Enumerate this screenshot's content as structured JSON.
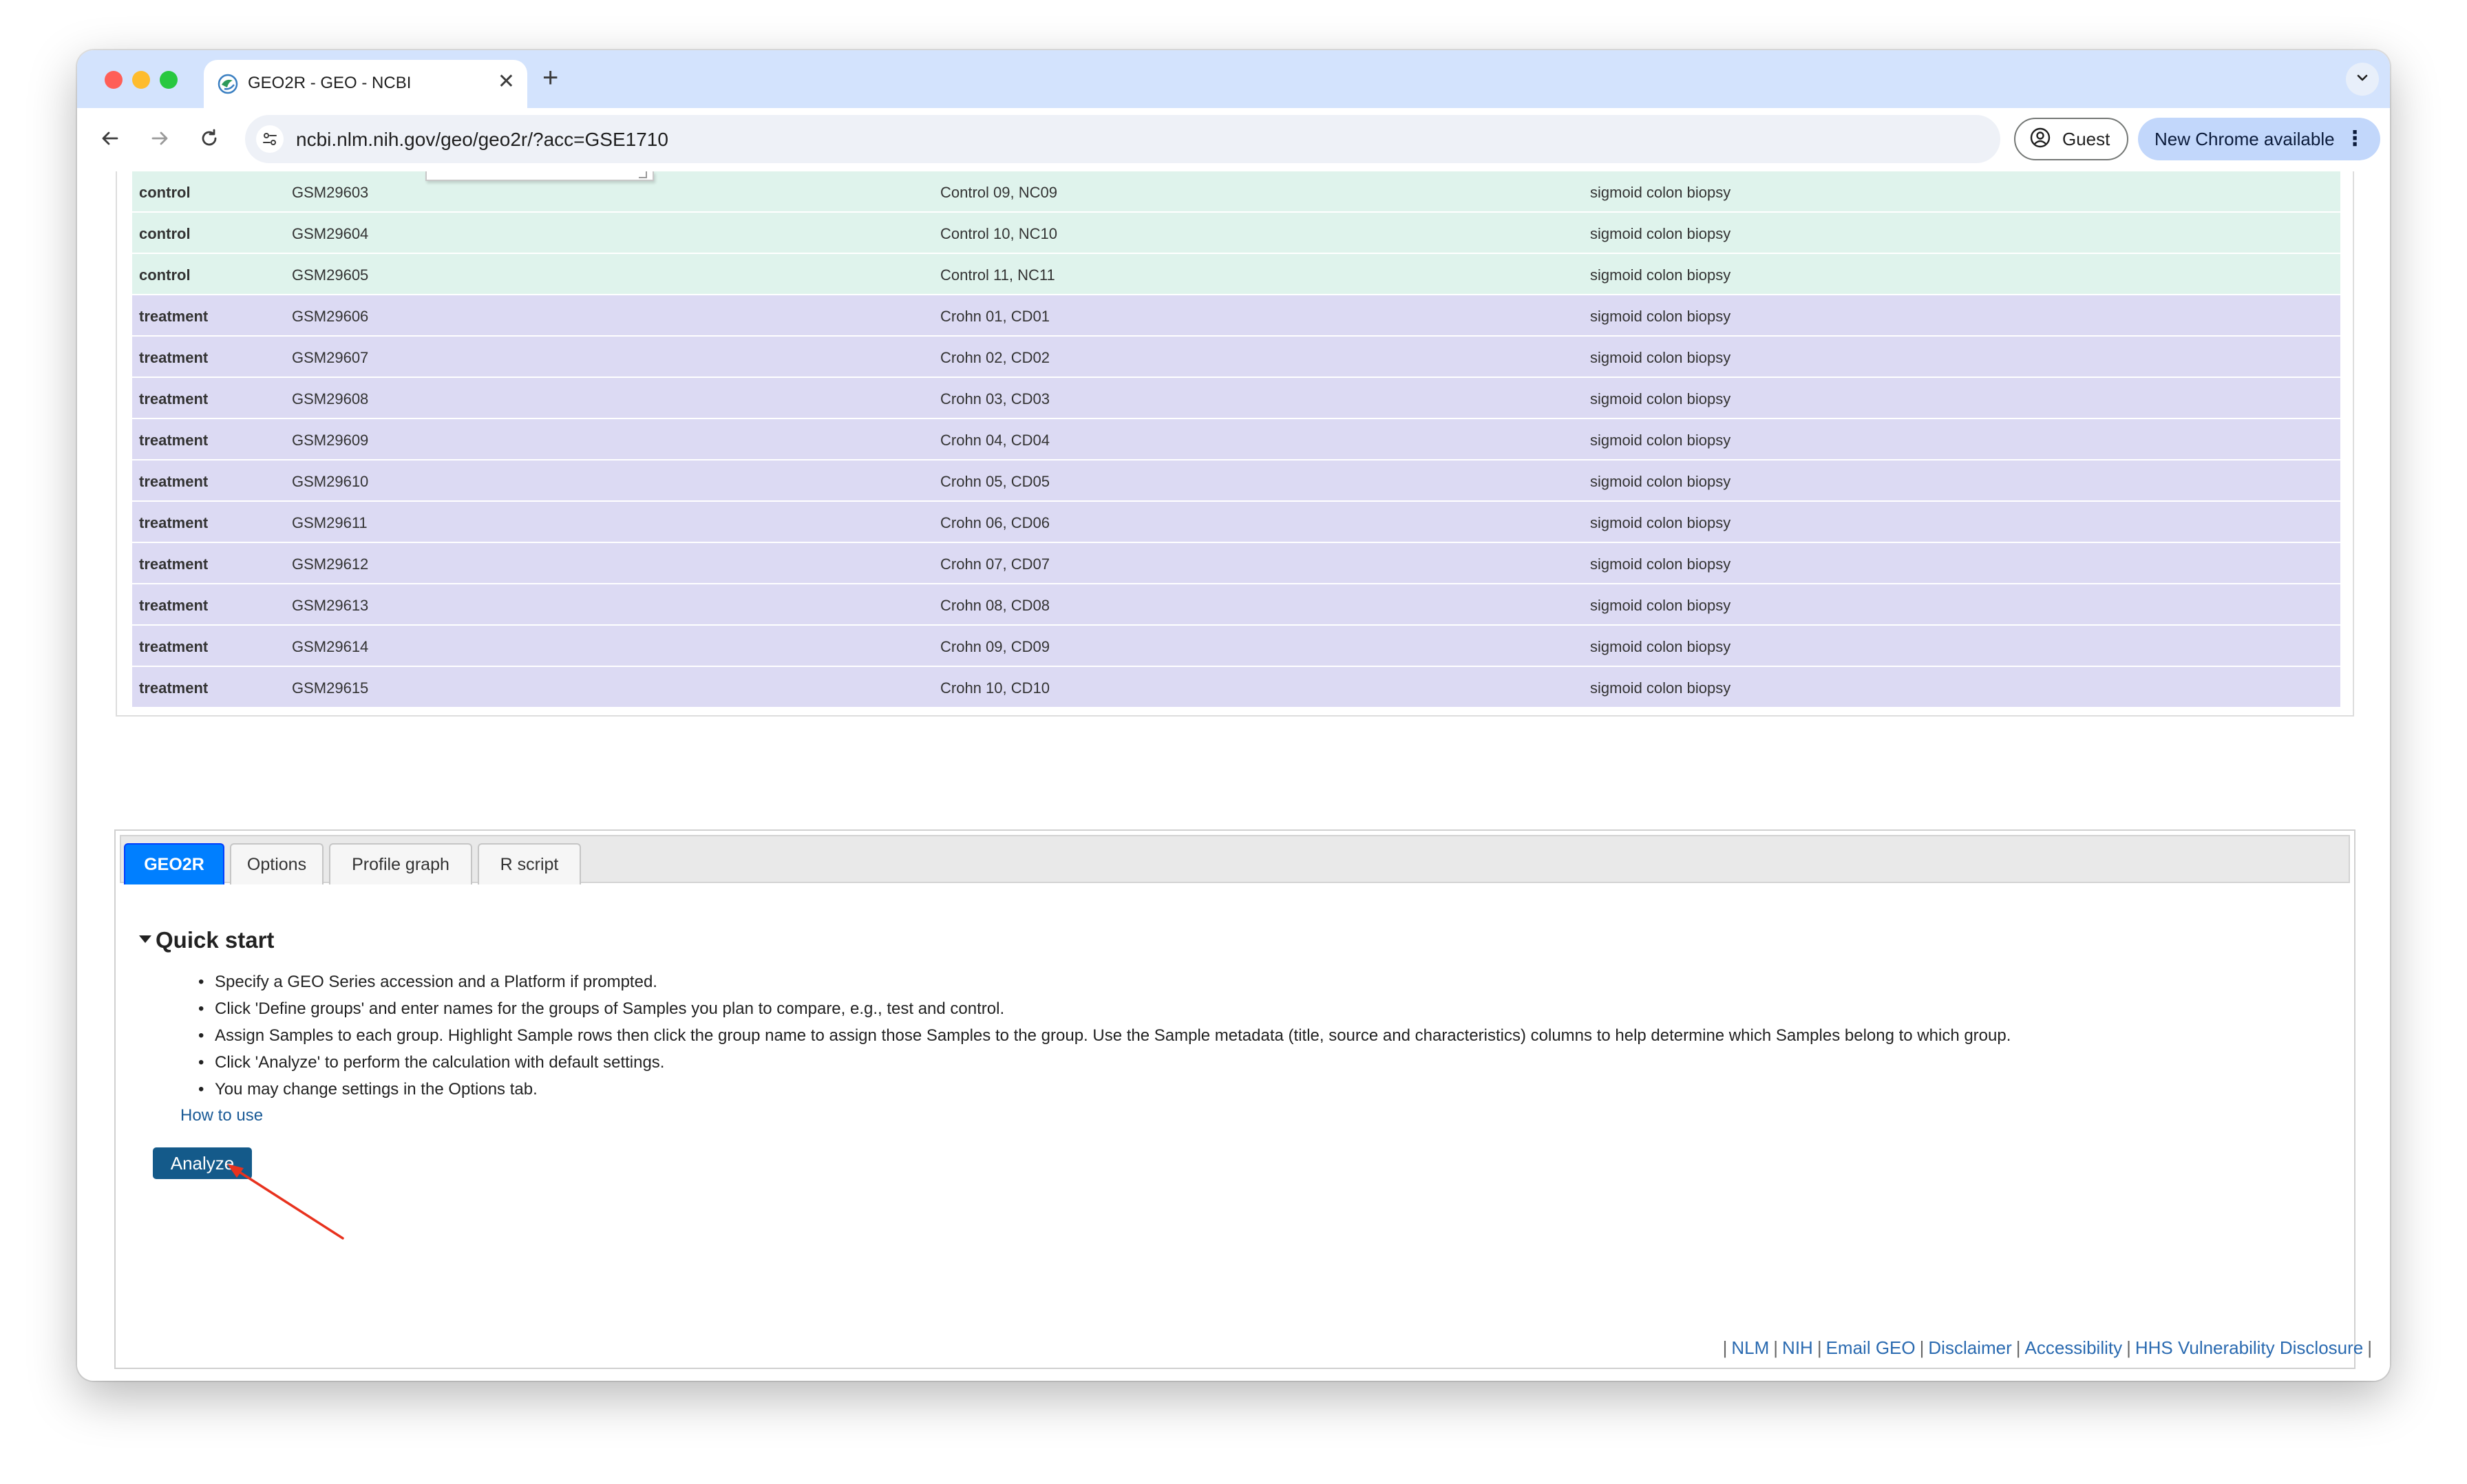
{
  "browser": {
    "tab_title": "GEO2R - GEO - NCBI",
    "tab_close": "✕",
    "new_tab": "+",
    "url": "ncbi.nlm.nih.gov/geo/geo2r/?acc=GSE1710",
    "guest_label": "Guest",
    "update_label": "New Chrome available",
    "update_menu": "⋮"
  },
  "samples": [
    {
      "group": "control",
      "accession": "GSM29603",
      "title": "Control 09, NC09",
      "source": "sigmoid colon biopsy"
    },
    {
      "group": "control",
      "accession": "GSM29604",
      "title": "Control 10, NC10",
      "source": "sigmoid colon biopsy"
    },
    {
      "group": "control",
      "accession": "GSM29605",
      "title": "Control 11, NC11",
      "source": "sigmoid colon biopsy"
    },
    {
      "group": "treatment",
      "accession": "GSM29606",
      "title": "Crohn 01, CD01",
      "source": "sigmoid colon biopsy"
    },
    {
      "group": "treatment",
      "accession": "GSM29607",
      "title": "Crohn 02, CD02",
      "source": "sigmoid colon biopsy"
    },
    {
      "group": "treatment",
      "accession": "GSM29608",
      "title": "Crohn 03, CD03",
      "source": "sigmoid colon biopsy"
    },
    {
      "group": "treatment",
      "accession": "GSM29609",
      "title": "Crohn 04, CD04",
      "source": "sigmoid colon biopsy"
    },
    {
      "group": "treatment",
      "accession": "GSM29610",
      "title": "Crohn 05, CD05",
      "source": "sigmoid colon biopsy"
    },
    {
      "group": "treatment",
      "accession": "GSM29611",
      "title": "Crohn 06, CD06",
      "source": "sigmoid colon biopsy"
    },
    {
      "group": "treatment",
      "accession": "GSM29612",
      "title": "Crohn 07, CD07",
      "source": "sigmoid colon biopsy"
    },
    {
      "group": "treatment",
      "accession": "GSM29613",
      "title": "Crohn 08, CD08",
      "source": "sigmoid colon biopsy"
    },
    {
      "group": "treatment",
      "accession": "GSM29614",
      "title": "Crohn 09, CD09",
      "source": "sigmoid colon biopsy"
    },
    {
      "group": "treatment",
      "accession": "GSM29615",
      "title": "Crohn 10, CD10",
      "source": "sigmoid colon biopsy"
    }
  ],
  "tabs": [
    {
      "label": "GEO2R",
      "active": true
    },
    {
      "label": "Options",
      "active": false
    },
    {
      "label": "Profile graph",
      "active": false
    },
    {
      "label": "R script",
      "active": false
    }
  ],
  "quick_start": {
    "title": "Quick start",
    "items": [
      "Specify a GEO Series accession and a Platform if prompted.",
      "Click 'Define groups' and enter names for the groups of Samples you plan to compare, e.g., test and control.",
      "Assign Samples to each group. Highlight Sample rows then click the group name to assign those Samples to the group. Use the Sample metadata (title, source and characteristics) columns to help determine which Samples belong to which group.",
      "Click 'Analyze' to perform the calculation with default settings.",
      "You may change settings in the Options tab."
    ],
    "how_to_use": "How to use",
    "analyze_label": "Analyze"
  },
  "footer": {
    "links": [
      "NLM",
      "NIH",
      "Email GEO",
      "Disclaimer",
      "Accessibility",
      "HHS Vulnerability Disclosure"
    ],
    "separator": "|"
  },
  "colors": {
    "control_row": "#dff3ec",
    "treatment_row": "#dcdaf3",
    "active_tab": "#007fff",
    "analyze_button": "#145a8a",
    "annotation_arrow": "#e8321e"
  },
  "icons": {
    "favicon": "ncbi-geo-icon",
    "back": "arrow-left-icon",
    "forward": "arrow-right-icon",
    "reload": "reload-icon",
    "site_info": "tune-icon",
    "profile": "account-circle-icon",
    "tab_search": "chevron-down-icon"
  }
}
